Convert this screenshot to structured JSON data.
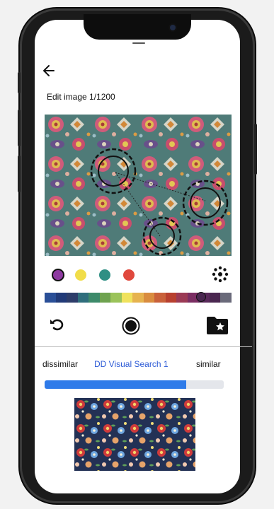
{
  "header": {
    "back_icon": "arrow-left-icon",
    "title": "Edit image 1/1200"
  },
  "colors": {
    "selected": [
      "#8e3aa1",
      "#f1dd49",
      "#2f8f84",
      "#e0483d"
    ],
    "palette": [
      "#2a4f97",
      "#213a78",
      "#2d3d6a",
      "#2f6e7c",
      "#3d8a6a",
      "#6ea24f",
      "#9bc35a",
      "#f0e25d",
      "#e6b34f",
      "#d98c3f",
      "#c9613a",
      "#b8402f",
      "#9b3a55",
      "#7b2e63",
      "#5a2a5b",
      "#4a2750",
      "#6a6a7a"
    ],
    "palette_selected_index": 15
  },
  "tools": {
    "sparkle_icon": "sparkle-icon",
    "undo_icon": "undo-icon",
    "record_icon": "record-icon",
    "folder_icon": "folder-star-icon"
  },
  "similarity": {
    "left_label": "dissimilar",
    "center_label": "DD Visual Search 1",
    "right_label": "similar",
    "value": 0.79
  }
}
